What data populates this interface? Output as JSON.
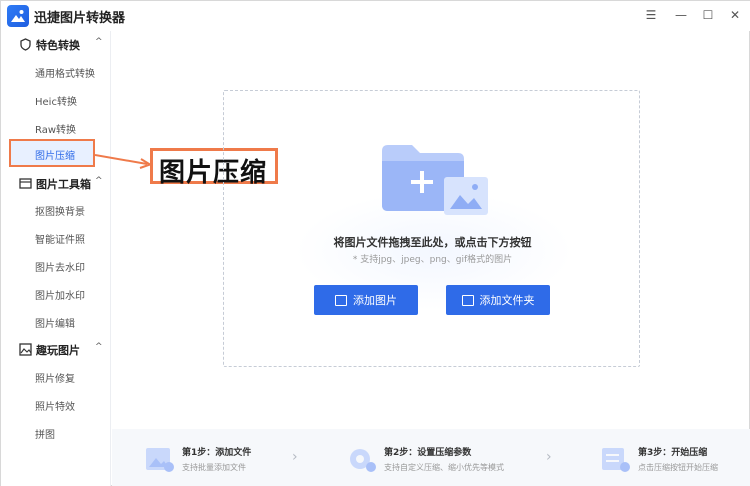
{
  "window": {
    "title": "迅捷图片转换器",
    "controls": {
      "menu": "☰",
      "minimize": "—",
      "maximize": "☐",
      "close": "✕"
    }
  },
  "sidebar": {
    "groups": [
      {
        "label": "特色转换",
        "icon": "badge-icon",
        "chevron": "^"
      },
      {
        "label": "图片工具箱",
        "icon": "toolbox-icon",
        "chevron": "^"
      },
      {
        "label": "趣玩图片",
        "icon": "fun-image-icon",
        "chevron": "^"
      }
    ],
    "items": [
      "通用格式转换",
      "Heic转换",
      "Raw转换",
      "图片压缩",
      "抠图换背景",
      "智能证件照",
      "图片去水印",
      "图片加水印",
      "图片编辑",
      "照片修复",
      "照片特效",
      "拼图"
    ],
    "active_item": "图片压缩"
  },
  "callout": {
    "text": "图片压缩"
  },
  "dropzone": {
    "title": "将图片文件拖拽至此处，或点击下方按钮",
    "subtitle": "* 支持jpg、jpeg、png、gif格式的图片",
    "add_image_label": "添加图片",
    "add_folder_label": "添加文件夹"
  },
  "steps": [
    {
      "title": "第1步：添加文件",
      "desc": "支持批量添加文件"
    },
    {
      "title": "第2步：设置压缩参数",
      "desc": "支持自定义压缩、缩小优先等模式"
    },
    {
      "title": "第3步：开始压缩",
      "desc": "点击压缩按钮开始压缩"
    }
  ],
  "colors": {
    "accent": "#2f6be8",
    "highlight": "#ef7a4a"
  }
}
